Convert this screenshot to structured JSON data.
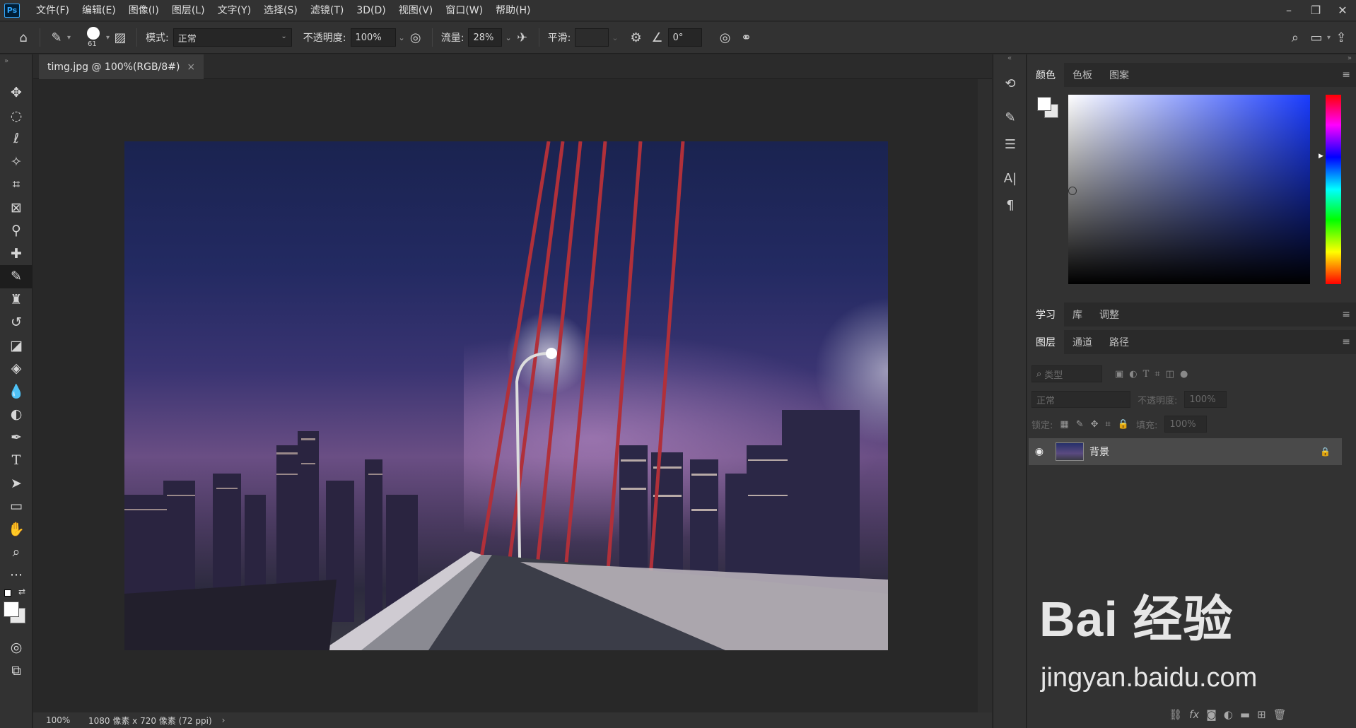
{
  "app": {
    "logo": "Ps"
  },
  "menu": [
    "文件(F)",
    "编辑(E)",
    "图像(I)",
    "图层(L)",
    "文字(Y)",
    "选择(S)",
    "滤镜(T)",
    "3D(D)",
    "视图(V)",
    "窗口(W)",
    "帮助(H)"
  ],
  "window_controls": {
    "minimize": "–",
    "restore": "❐",
    "close": "✕"
  },
  "options": {
    "brush_size": "61",
    "mode_label": "模式:",
    "mode_value": "正常",
    "opacity_label": "不透明度:",
    "opacity_value": "100%",
    "flow_label": "流量:",
    "flow_value": "28%",
    "smoothing_label": "平滑:",
    "smoothing_value": "",
    "angle_value": "0°"
  },
  "document": {
    "tab_title": "timg.jpg @ 100%(RGB/8#)",
    "close": "×"
  },
  "status": {
    "zoom": "100%",
    "info": "1080 像素 x 720 像素 (72 ppi)",
    "arrow": "›"
  },
  "color_panel": {
    "tabs": [
      "颜色",
      "色板",
      "图案"
    ],
    "active_tab": "颜色",
    "hue_color": "#1a3cff"
  },
  "learn_panel": {
    "tabs": [
      "学习",
      "库",
      "调整"
    ]
  },
  "layers_panel": {
    "tabs": [
      "图层",
      "通道",
      "路径"
    ],
    "filter_placeholder": "类型",
    "blend_mode": "正常",
    "opacity_label": "不透明度:",
    "opacity_value": "100%",
    "lock_label": "锁定:",
    "fill_label": "填充:",
    "fill_value": "100%",
    "layers": [
      {
        "name": "背景",
        "visible": true,
        "locked": true
      }
    ]
  },
  "watermark": {
    "main": "Bai 经验",
    "sub": "jingyan.baidu.com"
  }
}
